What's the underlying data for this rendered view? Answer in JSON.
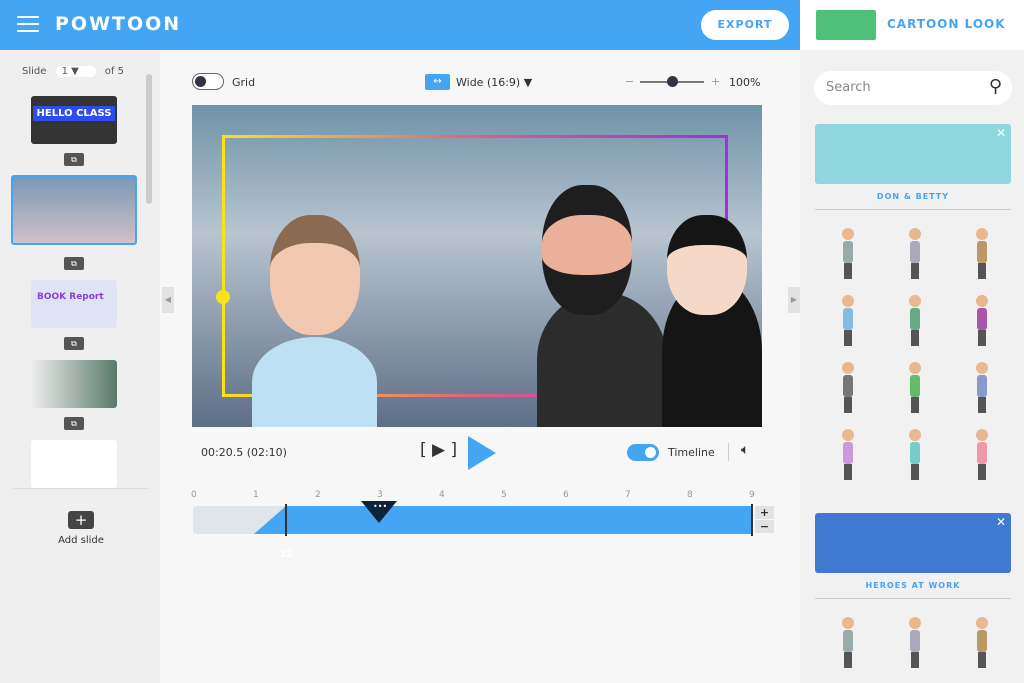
{
  "header": {
    "logo": "POWTOON",
    "export_label": "EXPORT"
  },
  "slides_panel": {
    "slide_label": "Slide",
    "current": "1",
    "of_label": "of 5",
    "add_slide_label": "Add slide",
    "thumbs": [
      {
        "title": "HELLO CLASS"
      },
      {
        "title": ""
      },
      {
        "title": "BOOK Report"
      },
      {
        "title": ""
      },
      {
        "title": ""
      }
    ]
  },
  "toolbar": {
    "grid_label": "Grid",
    "aspect_label": "Wide (16:9)",
    "zoom": "100%"
  },
  "playback": {
    "time": "00:20.5 (02:10)",
    "timeline_label": "Timeline"
  },
  "timeline": {
    "ticks": [
      "0",
      "1",
      "2",
      "3",
      "4",
      "5",
      "6",
      "7",
      "8",
      "9"
    ],
    "marker_label": "12",
    "plus": "+",
    "minus": "−"
  },
  "library": {
    "title": "CARTOON LOOK",
    "search_placeholder": "Search",
    "sets": [
      {
        "name": "DON & BETTY"
      },
      {
        "name": "HEROES AT WORK"
      }
    ]
  },
  "colors": {
    "accent": "#45a5f5",
    "panel": "#efefef"
  }
}
